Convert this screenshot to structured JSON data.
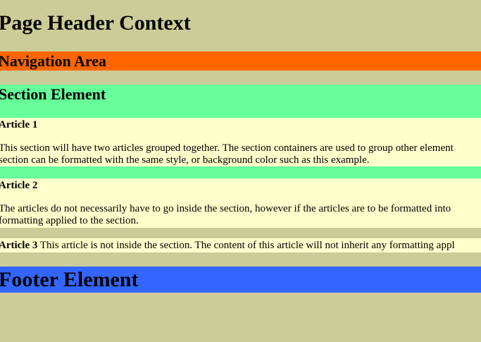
{
  "header": {
    "title": "Page Header Context"
  },
  "nav": {
    "title": "Navigation Area"
  },
  "section": {
    "title": "Section Element",
    "articles": [
      {
        "title": "Article 1",
        "lines": [
          "This section will have two articles grouped together. The section containers are used to group other element",
          "section can be formatted with the same style, or background color such as this example."
        ]
      },
      {
        "title": "Article 2",
        "lines": [
          "The articles do not necessarily have to go inside the section, however if the articles are to be formatted into",
          "formatting applied to the section."
        ]
      }
    ]
  },
  "standalone_article": {
    "title": "Article 3",
    "text": " This article is not inside the section. The content of this article will not inherit any formatting appl"
  },
  "footer": {
    "title": "Footer Element"
  },
  "colors": {
    "page_background": "#cccc99",
    "nav_background": "#ff6600",
    "section_background": "#66ff99",
    "article_background": "#ffffcc",
    "footer_background": "#3366ff"
  }
}
